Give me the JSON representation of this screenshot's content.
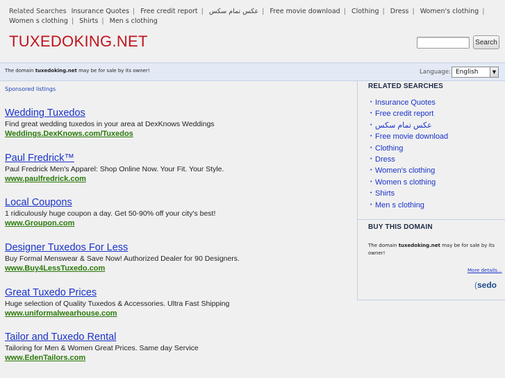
{
  "top_related": {
    "label": "Related Searches",
    "items": [
      "Insurance Quotes",
      "Free credit report",
      "عكس تمام سكس",
      "Free movie download",
      "Clothing",
      "Dress",
      "Women's clothing",
      "Women s clothing",
      "Shirts",
      "Men s clothing"
    ]
  },
  "site": {
    "title": "TUXEDOKING.NET"
  },
  "search": {
    "button": "Search"
  },
  "domain_bar": {
    "message_prefix": "The domain ",
    "domain": "tuxedoking.net",
    "message_suffix": " may be for sale by its owner!",
    "language_label": "Language:",
    "language_value": "English"
  },
  "sponsored_label": "Sponsored listings",
  "listings": [
    {
      "title": "Wedding Tuxedos",
      "desc": "Find great wedding tuxedos in your area at DexKnows Weddings",
      "url": "Weddings.DexKnows.com/Tuxedos"
    },
    {
      "title": "Paul Fredrick™",
      "desc": "Paul Fredrick Men's Apparel: Shop Online Now. Your Fit. Your Style.",
      "url": "www.paulfredrick.com"
    },
    {
      "title": "Local Coupons",
      "desc": "1 ridiculously huge coupon a day. Get 50-90% off your city's best!",
      "url": "www.Groupon.com"
    },
    {
      "title": "Designer Tuxedos For Less",
      "desc": "Buy Formal Menswear & Save Now! Authorized Dealer for 90 Designers.",
      "url": "www.Buy4LessTuxedo.com"
    },
    {
      "title": "Great Tuxedo Prices",
      "desc": "Huge selection of Quality Tuxedos & Accessories. Ultra Fast Shipping",
      "url": "www.uniformalwearhouse.com"
    },
    {
      "title": "Tailor and Tuxedo Rental",
      "desc": "Tailoring for Men & Women Great Prices. Same day Service",
      "url": "www.EdenTailors.com"
    }
  ],
  "sidebar": {
    "related_heading": "RELATED SEARCHES",
    "related_items": [
      "Insurance Quotes",
      "Free credit report",
      "عكس تمام سكس",
      "Free movie download",
      "Clothing",
      "Dress",
      "Women's clothing",
      "Women s clothing",
      "Shirts",
      "Men s clothing"
    ],
    "buy_heading": "BUY THIS DOMAIN",
    "buy_prefix": "The domain ",
    "buy_domain": "tuxedoking.net",
    "buy_suffix": " may be for sale by its owner!",
    "more_details": "More details...",
    "logo": "sedo"
  },
  "colors": {
    "title_red": "#c0141c",
    "link_blue": "#1a33c9",
    "url_green": "#2b7a0b",
    "bar_blue": "#e3eaf6"
  }
}
